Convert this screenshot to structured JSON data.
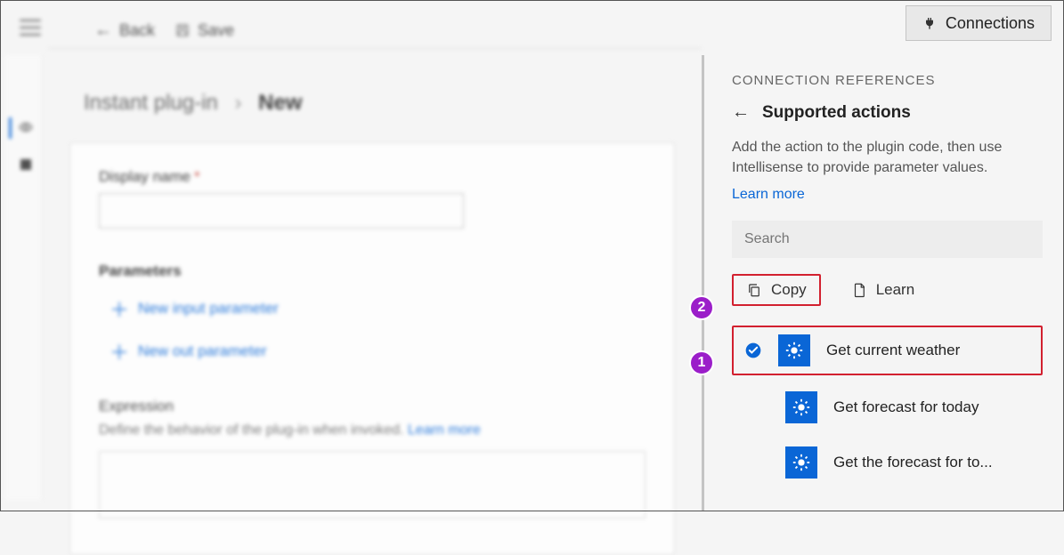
{
  "cmdbar": {
    "back": "Back",
    "save": "Save"
  },
  "connections_btn": "Connections",
  "breadcrumb": {
    "root": "Instant plug-in",
    "current": "New"
  },
  "form": {
    "display_name_label": "Display name",
    "params_head": "Parameters",
    "add_input": "New input parameter",
    "add_out": "New out parameter",
    "expr_head": "Expression",
    "expr_desc": "Define the behavior of the plug-in when invoked.",
    "expr_learn": "Learn more"
  },
  "right": {
    "heading": "CONNECTION REFERENCES",
    "title": "Supported actions",
    "desc": "Add the action to the plugin code, then use Intellisense to provide parameter values.",
    "learn": "Learn more",
    "search_placeholder": "Search",
    "copy": "Copy",
    "learn_btn": "Learn",
    "actions": [
      {
        "label": "Get current weather",
        "selected": true
      },
      {
        "label": "Get forecast for today",
        "selected": false
      },
      {
        "label": "Get the forecast for to...",
        "selected": false
      }
    ]
  },
  "badges": {
    "one": "1",
    "two": "2"
  }
}
